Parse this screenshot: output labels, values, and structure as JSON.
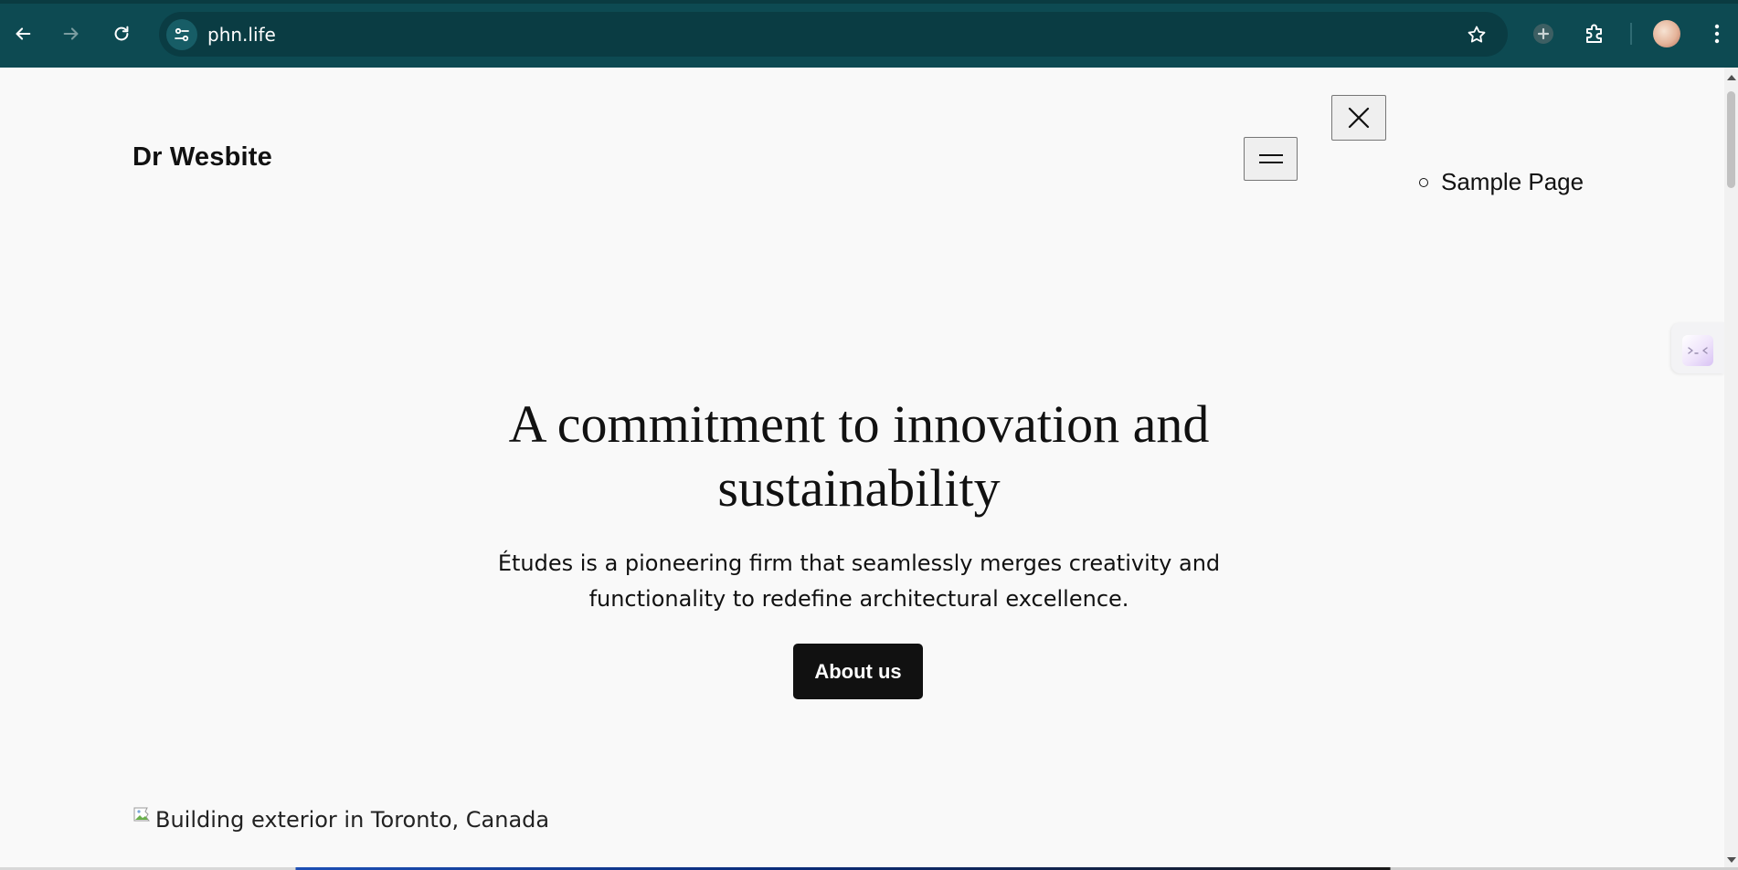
{
  "browser": {
    "url": "phn.life",
    "colors": {
      "chrome_bg": "#0d4a52",
      "omnibox_bg": "#0a3c43"
    },
    "icons": {
      "back": "arrow-left-icon",
      "forward": "arrow-right-icon",
      "reload": "reload-icon",
      "site_info": "tune-icon",
      "bookmark": "star-icon",
      "extension_add": "plus-circle-icon",
      "extensions": "puzzle-icon",
      "menu": "kebab-menu-icon"
    }
  },
  "site": {
    "title": "Dr Wesbite",
    "menu_open_icon": "hamburger-icon",
    "menu_close_icon": "close-icon",
    "nav_items": [
      {
        "label": "Sample Page"
      }
    ]
  },
  "hero": {
    "heading": "A commitment to innovation and sustainability",
    "subheading": "Études is a pioneering firm that seamlessly merges creativity and functionality to redefine architectural excellence.",
    "button_label": "About us"
  },
  "image": {
    "alt_text": "Building exterior in Toronto, Canada",
    "icon": "broken-image-icon"
  },
  "side_widget": {
    "icon": "assistant-widget-icon"
  }
}
